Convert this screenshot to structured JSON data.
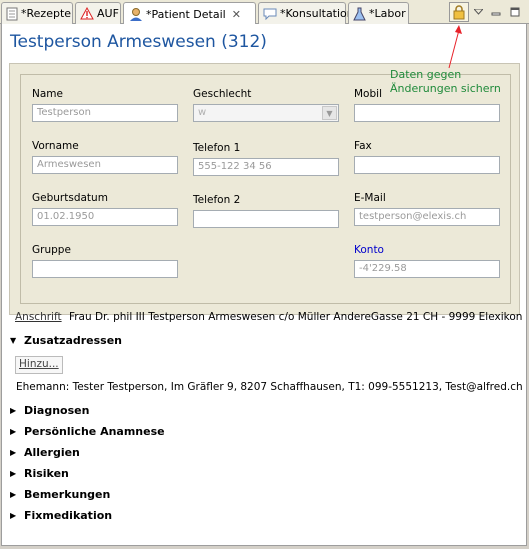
{
  "tabs": [
    {
      "label": "*Rezepte",
      "icon": "document-icon"
    },
    {
      "label": "AUF",
      "icon": "warning-icon"
    },
    {
      "label": "*Patient Detail",
      "icon": "patient-icon",
      "active": true
    },
    {
      "label": "*Konsultation",
      "icon": "speech-icon"
    },
    {
      "label": "*Labor",
      "icon": "flask-icon"
    }
  ],
  "toolbar": {
    "lock_icon": "lock-icon",
    "menu_icon": "triangle-down-icon",
    "minimize": "minimize-icon",
    "maximize": "maximize-icon"
  },
  "title": "Testperson Armeswesen (312)",
  "annotation": "Daten gegen\nÄnderungen sichern",
  "form": {
    "name_label": "Name",
    "name_value": "Testperson",
    "vorname_label": "Vorname",
    "vorname_value": "Armeswesen",
    "geburtsdatum_label": "Geburtsdatum",
    "geburtsdatum_value": "01.02.1950",
    "gruppe_label": "Gruppe",
    "gruppe_value": "",
    "geschlecht_label": "Geschlecht",
    "geschlecht_value": "w",
    "telefon1_label": "Telefon 1",
    "telefon1_value": "555-122 34 56",
    "telefon2_label": "Telefon 2",
    "telefon2_value": "",
    "mobil_label": "Mobil",
    "mobil_value": "",
    "fax_label": "Fax",
    "fax_value": "",
    "email_label": "E-Mail",
    "email_value": "testperson@elexis.ch",
    "konto_label": "Konto",
    "konto_value": "-4'229.58"
  },
  "anschrift": {
    "label": "Anschrift",
    "value": "Frau Dr. phil III Testperson Armeswesen c/o Müller AndereGasse 21 CH - 9999 Elexikon"
  },
  "zusatzadressen": {
    "label": "Zusatzadressen",
    "button": "Hinzu...",
    "entry": "Ehemann: Tester Testperson, Im Gräfler 9, 8207 Schaffhausen, T1: 099-5551213, Test@alfred.ch"
  },
  "sections": [
    "Diagnosen",
    "Persönliche Anamnese",
    "Allergien",
    "Risiken",
    "Bemerkungen",
    "Fixmedikation"
  ],
  "colors": {
    "title": "#1e56a0",
    "annotation": "#1f8a3a",
    "arrow": "#e8222a",
    "link": "#0000cc"
  }
}
